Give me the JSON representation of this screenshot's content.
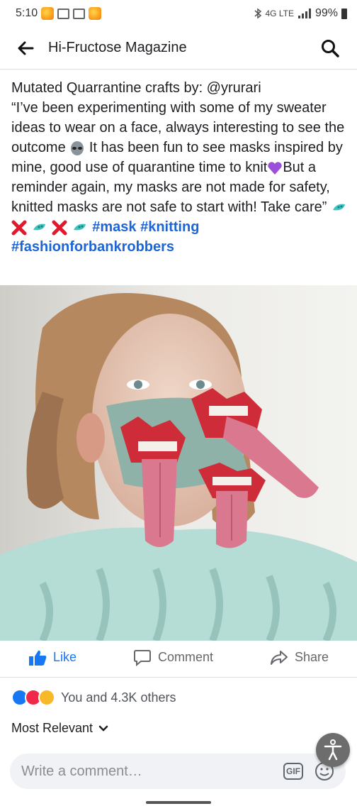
{
  "status_bar": {
    "time": "5:10",
    "network": "4G LTE",
    "battery": "99%"
  },
  "header": {
    "title": "Hi-Fructose Magazine",
    "back_icon": "arrow-left-icon",
    "search_icon": "search-icon"
  },
  "post": {
    "line1": "Mutated Quarrantine crafts by:  @yrurari",
    "body": "“I’ve been experimenting with some of my sweater ideas to wear on a face, always interesting to see the outcome",
    "body2": " It has been fun to see masks inspired by mine, good use of quarantine time to knit",
    "body3": "But a reminder again, my masks are not made for safety, knitted masks are not safe to start with! Take care”",
    "hashtags": [
      "#mask",
      "#knitting",
      "#fashionforbankrobbers"
    ]
  },
  "actions": {
    "like": "Like",
    "comment": "Comment",
    "share": "Share"
  },
  "reactions": {
    "summary": "You and 4.3K others"
  },
  "comments": {
    "sort_label": "Most Relevant",
    "placeholder": "Write a comment…",
    "gif_label": "GIF"
  },
  "colors": {
    "accent": "#1877f2",
    "hashtag": "#1c65d6",
    "muted": "#65676b"
  }
}
